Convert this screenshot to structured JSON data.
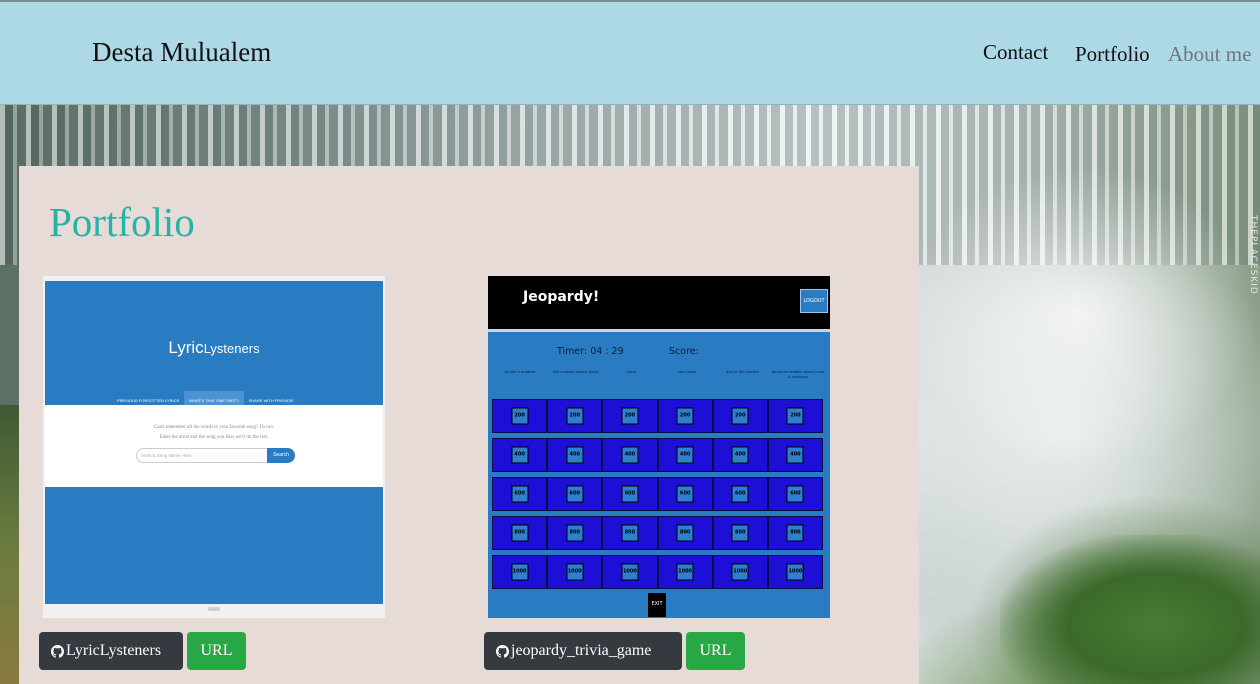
{
  "navbar": {
    "brand": "Desta Mulualem",
    "links": [
      {
        "label": "Contact"
      },
      {
        "label": "Portfolio"
      },
      {
        "label": "About me"
      }
    ]
  },
  "background": {
    "watermark": "THEPLACESKID"
  },
  "portfolio": {
    "title": "Portfolio",
    "projects": [
      {
        "repo_label": "LyricLysteners",
        "url_label": "URL",
        "preview": {
          "logo_main": "Lyric",
          "logo_sub": "Lysteners",
          "nav": [
            "PREVIOUS FORGOTTEN LYRICS",
            "WHAT'S THAT ONE PART?",
            "SHARE WITH FRIENDS!"
          ],
          "hint_line1": "Can't remember all the words to your favorite song? Us too.",
          "hint_line2": "Enter the artist and the song you like, we'll do the rest.",
          "input_placeholder": "Artist & Song Name Here",
          "search_label": "Search"
        }
      },
      {
        "repo_label": "jeopardy_trivia_game",
        "url_label": "URL",
        "preview": {
          "title": "Jeopardy!",
          "logout": "LOGOUT",
          "timer": "Timer: 04 : 29",
          "score": "Score:",
          "categories": [
            "on the turntable",
            "the scream actors guild",
            "mma",
            "your pass",
            "dial m for murder",
            "beyonce knows naked prize & advisory"
          ],
          "values": [
            "200",
            "400",
            "600",
            "800",
            "1000"
          ],
          "exit": "EXIT"
        }
      }
    ]
  },
  "colors": {
    "navbar_bg": "#add8e6",
    "card_bg": "#e6dbd6",
    "title": "#26b3a6",
    "repo_button": "#343a40",
    "url_button": "#28a745"
  }
}
